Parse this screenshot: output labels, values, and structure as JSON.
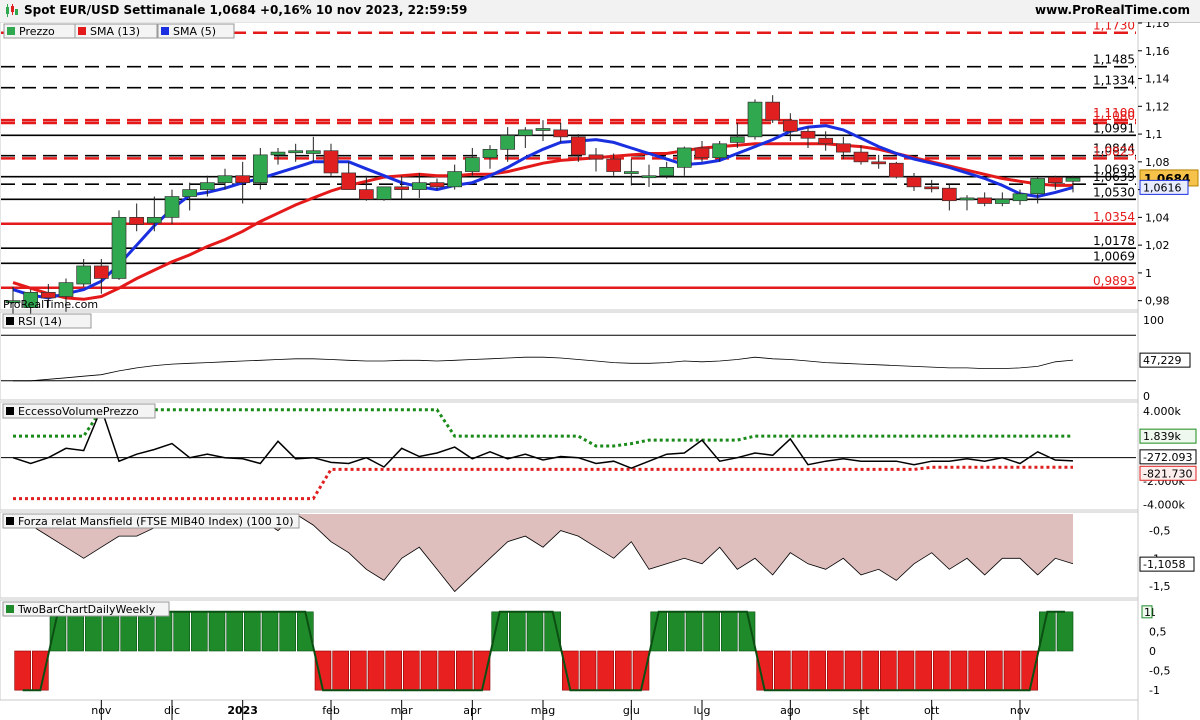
{
  "header": {
    "title": "Spot EUR/USD Settimanale 1,0684 +0,16% 10 nov 2023, 22:59:59",
    "brand": "www.ProRealTime.com",
    "watermark": "ProRealTime.com"
  },
  "colors": {
    "up": "#2fa84f",
    "down": "#e02020",
    "sma13": "#e41a1a",
    "sma5": "#1a2fe0",
    "mansfield_fill": "#d9b3b3"
  },
  "chart_data": [
    {
      "type": "candlestick",
      "legend": [
        "Prezzo",
        "SMA (13)",
        "SMA (5)"
      ],
      "y_ticks": [
        "1,18",
        "1,16",
        "1,14",
        "1,12",
        "1,1",
        "1,08",
        "1,06",
        "1,04",
        "1,02",
        "1",
        "0,98"
      ],
      "ylim": [
        0.974,
        1.18
      ],
      "last_price": "1,0684",
      "sma5_last": "1,0616",
      "levels": [
        {
          "label": "1,1730",
          "value": 1.173,
          "color": "red",
          "style": "dashed"
        },
        {
          "label": "1,1485",
          "value": 1.1485,
          "color": "black",
          "style": "dashed"
        },
        {
          "label": "1,1334",
          "value": 1.1334,
          "color": "black",
          "style": "dashed"
        },
        {
          "label": "1,1100",
          "value": 1.11,
          "color": "red",
          "style": "dashed"
        },
        {
          "label": "1,1080",
          "value": 1.108,
          "color": "red",
          "style": "dashed"
        },
        {
          "label": "1,0991",
          "value": 1.0991,
          "color": "black",
          "style": "solid"
        },
        {
          "label": "1,0844",
          "value": 1.0844,
          "color": "black",
          "style": "dashed"
        },
        {
          "label": "1,0825",
          "value": 1.0825,
          "color": "red",
          "style": "dashed"
        },
        {
          "label": "1,0693",
          "value": 1.0693,
          "color": "black",
          "style": "solid"
        },
        {
          "label": "1,0639",
          "value": 1.0639,
          "color": "black",
          "style": "dashed"
        },
        {
          "label": "1,0530",
          "value": 1.053,
          "color": "black",
          "style": "solid"
        },
        {
          "label": "1,0354",
          "value": 1.0354,
          "color": "red",
          "style": "solid"
        },
        {
          "label": "1,0178",
          "value": 1.0178,
          "color": "black",
          "style": "solid"
        },
        {
          "label": "1,0069",
          "value": 1.0069,
          "color": "black",
          "style": "solid"
        },
        {
          "label": "0,9893",
          "value": 0.9893,
          "color": "red",
          "style": "solid"
        }
      ],
      "candles": [
        [
          0.98,
          0.99,
          0.97,
          0.98
        ],
        [
          0.975,
          0.988,
          0.97,
          0.986
        ],
        [
          0.986,
          0.992,
          0.975,
          0.982
        ],
        [
          0.983,
          0.996,
          0.972,
          0.993
        ],
        [
          0.992,
          1.01,
          0.99,
          1.005
        ],
        [
          1.005,
          1.01,
          0.985,
          0.996
        ],
        [
          0.996,
          1.045,
          0.995,
          1.04
        ],
        [
          1.04,
          1.05,
          1.03,
          1.035
        ],
        [
          1.036,
          1.055,
          1.03,
          1.04
        ],
        [
          1.04,
          1.06,
          1.035,
          1.055
        ],
        [
          1.055,
          1.065,
          1.045,
          1.06
        ],
        [
          1.06,
          1.07,
          1.055,
          1.065
        ],
        [
          1.065,
          1.075,
          1.06,
          1.07
        ],
        [
          1.07,
          1.08,
          1.05,
          1.065
        ],
        [
          1.065,
          1.09,
          1.06,
          1.085
        ],
        [
          1.085,
          1.09,
          1.078,
          1.087
        ],
        [
          1.087,
          1.093,
          1.08,
          1.088
        ],
        [
          1.086,
          1.098,
          1.08,
          1.088
        ],
        [
          1.088,
          1.093,
          1.07,
          1.072
        ],
        [
          1.072,
          1.08,
          1.06,
          1.06
        ],
        [
          1.06,
          1.07,
          1.052,
          1.053
        ],
        [
          1.053,
          1.062,
          1.052,
          1.062
        ],
        [
          1.062,
          1.07,
          1.053,
          1.06
        ],
        [
          1.06,
          1.072,
          1.054,
          1.065
        ],
        [
          1.065,
          1.068,
          1.06,
          1.062
        ],
        [
          1.062,
          1.078,
          1.06,
          1.073
        ],
        [
          1.073,
          1.09,
          1.07,
          1.083
        ],
        [
          1.083,
          1.092,
          1.075,
          1.089
        ],
        [
          1.089,
          1.105,
          1.08,
          1.099
        ],
        [
          1.099,
          1.105,
          1.09,
          1.103
        ],
        [
          1.103,
          1.11,
          1.095,
          1.104
        ],
        [
          1.103,
          1.108,
          1.094,
          1.098
        ],
        [
          1.098,
          1.1,
          1.08,
          1.085
        ],
        [
          1.085,
          1.09,
          1.073,
          1.082
        ],
        [
          1.082,
          1.086,
          1.07,
          1.073
        ],
        [
          1.073,
          1.082,
          1.063,
          1.073
        ],
        [
          1.07,
          1.078,
          1.062,
          1.07
        ],
        [
          1.07,
          1.08,
          1.068,
          1.076
        ],
        [
          1.076,
          1.091,
          1.07,
          1.09
        ],
        [
          1.09,
          1.095,
          1.08,
          1.083
        ],
        [
          1.083,
          1.095,
          1.08,
          1.093
        ],
        [
          1.094,
          1.108,
          1.09,
          1.098
        ],
        [
          1.098,
          1.125,
          1.096,
          1.123
        ],
        [
          1.123,
          1.128,
          1.108,
          1.11
        ],
        [
          1.11,
          1.115,
          1.095,
          1.102
        ],
        [
          1.102,
          1.105,
          1.09,
          1.097
        ],
        [
          1.097,
          1.102,
          1.088,
          1.093
        ],
        [
          1.093,
          1.098,
          1.082,
          1.087
        ],
        [
          1.087,
          1.092,
          1.078,
          1.08
        ],
        [
          1.08,
          1.085,
          1.075,
          1.079
        ],
        [
          1.079,
          1.08,
          1.068,
          1.069
        ],
        [
          1.069,
          1.072,
          1.059,
          1.062
        ],
        [
          1.062,
          1.067,
          1.058,
          1.061
        ],
        [
          1.061,
          1.064,
          1.045,
          1.052
        ],
        [
          1.053,
          1.056,
          1.045,
          1.054
        ],
        [
          1.054,
          1.058,
          1.048,
          1.05
        ],
        [
          1.05,
          1.058,
          1.048,
          1.053
        ],
        [
          1.052,
          1.06,
          1.049,
          1.057
        ],
        [
          1.057,
          1.069,
          1.05,
          1.068
        ],
        [
          1.069,
          1.07,
          1.06,
          1.065
        ],
        [
          1.066,
          1.07,
          1.058,
          1.0684
        ]
      ],
      "sma13": [
        0.993,
        0.989,
        0.985,
        0.982,
        0.981,
        0.983,
        0.989,
        0.996,
        1.002,
        1.008,
        1.013,
        1.019,
        1.024,
        1.03,
        1.037,
        1.043,
        1.049,
        1.054,
        1.059,
        1.063,
        1.066,
        1.069,
        1.07,
        1.071,
        1.07,
        1.07,
        1.071,
        1.071,
        1.073,
        1.076,
        1.079,
        1.081,
        1.082,
        1.083,
        1.084,
        1.085,
        1.086,
        1.086,
        1.088,
        1.09,
        1.091,
        1.092,
        1.093,
        1.093,
        1.093,
        1.093,
        1.093,
        1.092,
        1.091,
        1.089,
        1.086,
        1.083,
        1.08,
        1.077,
        1.074,
        1.071,
        1.068,
        1.066,
        1.064,
        1.063,
        1.063
      ],
      "sma5": [
        0.988,
        0.984,
        0.982,
        0.985,
        0.988,
        0.994,
        1.006,
        1.02,
        1.034,
        1.046,
        1.056,
        1.058,
        1.061,
        1.065,
        1.068,
        1.072,
        1.076,
        1.08,
        1.08,
        1.08,
        1.075,
        1.07,
        1.065,
        1.062,
        1.06,
        1.063,
        1.065,
        1.07,
        1.076,
        1.083,
        1.089,
        1.094,
        1.095,
        1.096,
        1.094,
        1.09,
        1.086,
        1.082,
        1.078,
        1.079,
        1.081,
        1.086,
        1.091,
        1.096,
        1.102,
        1.105,
        1.106,
        1.103,
        1.097,
        1.091,
        1.086,
        1.082,
        1.079,
        1.076,
        1.072,
        1.068,
        1.063,
        1.057,
        1.055,
        1.058,
        1.0616
      ]
    },
    {
      "type": "line",
      "title": "RSI (14)",
      "y_ticks": [
        "100",
        "0"
      ],
      "ylim": [
        0,
        100
      ],
      "level_lines": [
        80,
        20
      ],
      "last_value": "47,229",
      "values": [
        20,
        20,
        22,
        24,
        26,
        28,
        33,
        37,
        40,
        42,
        43,
        44,
        45,
        46,
        47,
        48,
        49,
        49,
        48,
        47,
        46,
        46,
        47,
        47,
        46,
        47,
        48,
        49,
        50,
        51,
        51,
        50,
        48,
        46,
        44,
        43,
        43,
        44,
        46,
        45,
        46,
        48,
        51,
        49,
        48,
        46,
        44,
        43,
        42,
        41,
        40,
        39,
        38,
        37,
        37,
        36,
        36,
        37,
        39,
        45,
        47.2
      ]
    },
    {
      "type": "line",
      "title": "EccessoVolumePrezzo",
      "y_ticks": [
        "4.000k",
        "2.000k",
        "0",
        "-2.000k",
        "-4.000k"
      ],
      "ylim": [
        -4300,
        4500
      ],
      "last_values": [
        "1.839k",
        "-272.093",
        "-821.730"
      ],
      "upper_band": [
        1839,
        1839,
        1839,
        1839,
        1839,
        4100,
        4100,
        4100,
        4100,
        4100,
        4100,
        4100,
        4100,
        4100,
        4100,
        4100,
        4100,
        4100,
        4100,
        4100,
        4100,
        4100,
        4100,
        4100,
        4100,
        1839,
        1839,
        1839,
        1839,
        1839,
        1839,
        1839,
        1839,
        1000,
        1000,
        1200,
        1500,
        1500,
        1500,
        1500,
        1500,
        1500,
        1839,
        1839,
        1839,
        1839,
        1839,
        1839,
        1839,
        1839,
        1839,
        1839,
        1839,
        1839,
        1839,
        1839,
        1839,
        1839,
        1839,
        1839,
        1839
      ],
      "lower_band": [
        -3500,
        -3500,
        -3500,
        -3500,
        -3500,
        -3500,
        -3500,
        -3500,
        -3500,
        -3500,
        -3500,
        -3500,
        -3500,
        -3500,
        -3500,
        -3500,
        -3500,
        -3500,
        -1000,
        -1000,
        -1000,
        -1000,
        -1000,
        -1000,
        -1000,
        -1000,
        -1000,
        -1000,
        -1000,
        -1000,
        -1000,
        -1000,
        -1000,
        -1000,
        -1000,
        -1000,
        -1000,
        -1000,
        -1000,
        -1000,
        -1000,
        -1000,
        -1000,
        -1000,
        -1000,
        -1000,
        -1000,
        -1000,
        -1000,
        -1000,
        -1000,
        -1000,
        -821,
        -821,
        -821,
        -821,
        -821,
        -821,
        -821,
        -821,
        -821
      ],
      "values": [
        0,
        -500,
        0,
        800,
        600,
        4200,
        -300,
        300,
        700,
        1200,
        0,
        300,
        0,
        -100,
        -500,
        1400,
        -100,
        0,
        -400,
        -500,
        0,
        -800,
        800,
        100,
        400,
        900,
        -100,
        500,
        -100,
        300,
        -200,
        100,
        0,
        -500,
        -300,
        -900,
        -300,
        300,
        400,
        1500,
        -300,
        0,
        400,
        200,
        1600,
        -600,
        -300,
        -100,
        -300,
        -300,
        -300,
        -600,
        -300,
        -300,
        -100,
        -300,
        0,
        -500,
        500,
        -200,
        -272
      ]
    },
    {
      "type": "area",
      "title": "Forza relat Mansfield (FTSE MIB40 Index) (100 10)",
      "y_ticks": [
        "-0,5",
        "-1",
        "-1,5"
      ],
      "ylim": [
        -1.7,
        -0.2
      ],
      "last_value": "-1,1058",
      "values": [
        -0.25,
        -0.4,
        -0.6,
        -0.8,
        -1.0,
        -0.8,
        -0.6,
        -0.6,
        -0.45,
        -0.25,
        -0.2,
        -0.4,
        -0.3,
        -0.2,
        -0.3,
        -0.5,
        -0.2,
        -0.4,
        -0.7,
        -0.9,
        -1.2,
        -1.4,
        -1.0,
        -0.8,
        -1.2,
        -1.6,
        -1.3,
        -1.0,
        -0.7,
        -0.6,
        -0.8,
        -0.5,
        -0.6,
        -0.8,
        -1.0,
        -0.7,
        -1.2,
        -1.1,
        -1.0,
        -1.1,
        -0.8,
        -1.2,
        -1.0,
        -1.3,
        -0.9,
        -1.1,
        -1.2,
        -1.0,
        -1.3,
        -1.2,
        -1.4,
        -1.1,
        -0.9,
        -1.2,
        -1.0,
        -1.3,
        -1.0,
        -1.0,
        -1.3,
        -1.0,
        -1.1
      ]
    },
    {
      "type": "bar",
      "title": "TwoBarChartDailyWeekly",
      "y_ticks": [
        "1",
        "0,5",
        "0",
        "-0,5",
        "-1"
      ],
      "ylim": [
        -1.2,
        1.2
      ],
      "last_value": "1",
      "values": [
        -1,
        -1,
        1,
        1,
        1,
        1,
        1,
        1,
        1,
        1,
        1,
        1,
        1,
        1,
        1,
        1,
        1,
        -1,
        -1,
        -1,
        -1,
        -1,
        -1,
        -1,
        -1,
        -1,
        -1,
        1,
        1,
        1,
        1,
        -1,
        -1,
        -1,
        -1,
        -1,
        1,
        1,
        1,
        1,
        1,
        1,
        -1,
        -1,
        -1,
        -1,
        -1,
        -1,
        -1,
        -1,
        -1,
        -1,
        -1,
        -1,
        -1,
        -1,
        -1,
        -1,
        1,
        1
      ]
    }
  ],
  "x_axis": {
    "labels": [
      {
        "text": "nov",
        "bar": 5
      },
      {
        "text": "dic",
        "bar": 9
      },
      {
        "text": "2023",
        "bar": 13
      },
      {
        "text": "feb",
        "bar": 18
      },
      {
        "text": "mar",
        "bar": 22
      },
      {
        "text": "apr",
        "bar": 26
      },
      {
        "text": "mag",
        "bar": 30
      },
      {
        "text": "giu",
        "bar": 35
      },
      {
        "text": "lug",
        "bar": 39
      },
      {
        "text": "ago",
        "bar": 44
      },
      {
        "text": "set",
        "bar": 48
      },
      {
        "text": "ott",
        "bar": 52
      },
      {
        "text": "nov",
        "bar": 57
      }
    ]
  }
}
